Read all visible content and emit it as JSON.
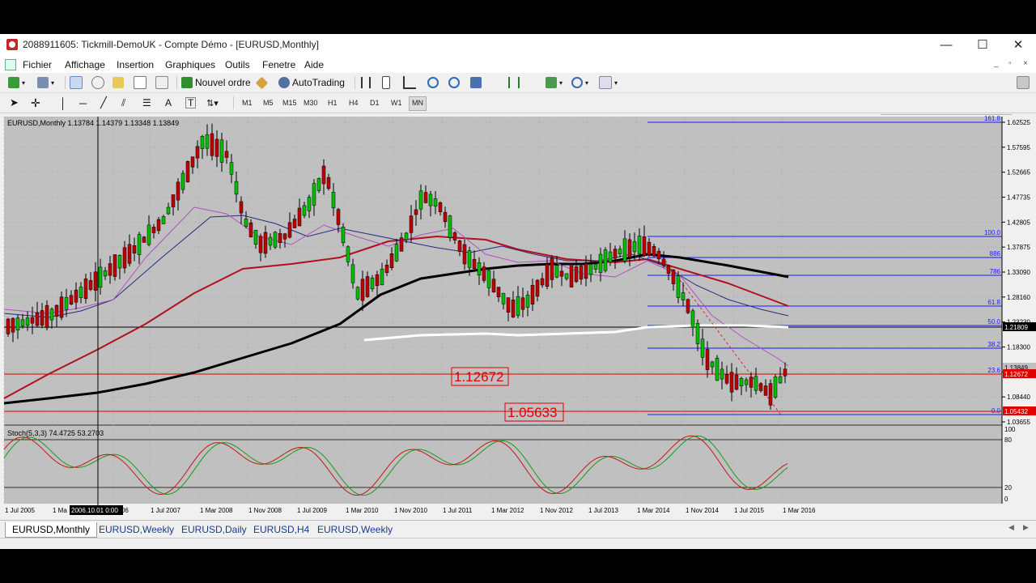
{
  "window": {
    "title": "2088911605: Tickmill-DemoUK - Compte Démo - [EURUSD,Monthly]",
    "controls": {
      "minimize": "—",
      "maximize": "☐",
      "close": "✕"
    }
  },
  "menu": {
    "items": [
      "Fichier",
      "Affichage",
      "Insertion",
      "Graphiques",
      "Outils",
      "Fenetre",
      "Aide"
    ],
    "mdi_controls": [
      "_",
      "▫",
      "×"
    ]
  },
  "toolbar": {
    "new_order": "Nouvel ordre",
    "autotrading": "AutoTrading",
    "search_placeholder": ""
  },
  "timeframes": [
    "M1",
    "M5",
    "M15",
    "M30",
    "H1",
    "H4",
    "D1",
    "W1",
    "MN"
  ],
  "selected_timeframe": "MN",
  "chart": {
    "header": "EURUSD,Monthly  1.13784 1.14379 1.13348 1.13849",
    "stoch_header": "Stoch(5,3,3) 74.4725 53.2703",
    "price_labels": [
      "1.62525",
      "1.57595",
      "1.52665",
      "1.47735",
      "1.42805",
      "1.37875",
      "1.33090",
      "1.28160",
      "1.23230",
      "1.18300",
      "1.13849",
      "1.08440",
      "1.03655"
    ],
    "current_price_tag": "1.21809",
    "red_tag_1": "1.12672",
    "red_tag_2": "1.05432",
    "bid_tag": "1.13849",
    "level_label_1": "1.12672",
    "level_label_2": "1.05633",
    "fib_labels": [
      "161.8",
      "100.0",
      "886",
      "786",
      "61.8",
      "50.0",
      "38.2",
      "23.6",
      "0.0"
    ],
    "stoch_scale": [
      "100",
      "80",
      "20",
      "0"
    ],
    "date_labels": [
      "1 Jul 2005",
      "1 Ma",
      "2006",
      "1 Jul 2007",
      "1 Mar 2008",
      "1 Nov 2008",
      "1 Jul 2009",
      "1 Mar 2010",
      "1 Nov 2010",
      "1 Jul 2011",
      "1 Mar 2012",
      "1 Nov 2012",
      "1 Jul 2013",
      "1 Mar 2014",
      "1 Nov 2014",
      "1 Jul 2015",
      "1 Mar 2016"
    ],
    "crosshair_date": "2006.10.01 0:00",
    "colors": {
      "background": "#c0c0c0",
      "bull": "#00c000",
      "bear": "#c00000",
      "grid": "#a8a8a8",
      "fib": "#1a1aff",
      "level": "#e00000"
    }
  },
  "tabs": [
    "EURUSD,Monthly",
    "EURUSD,Weekly",
    "EURUSD,Daily",
    "EURUSD,H4",
    "EURUSD,Weekly"
  ],
  "active_tab": "EURUSD,Monthly"
}
